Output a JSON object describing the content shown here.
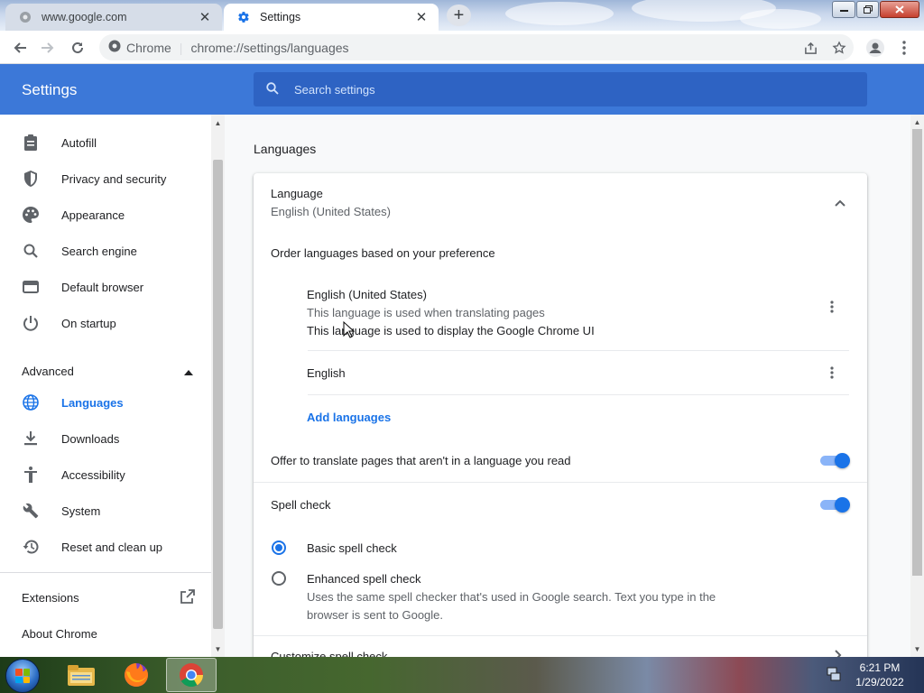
{
  "tabs": [
    {
      "title": "www.google.com",
      "close": "✕"
    },
    {
      "title": "Settings",
      "close": "✕"
    }
  ],
  "new_tab": "+",
  "omnibox": {
    "site_chip": "Chrome",
    "separator": "|",
    "url": "chrome://settings/languages"
  },
  "settings": {
    "title": "Settings",
    "search_placeholder": "Search settings"
  },
  "sidebar": {
    "items": [
      {
        "label": "Autofill",
        "icon": "clipboard-icon"
      },
      {
        "label": "Privacy and security",
        "icon": "shield-icon"
      },
      {
        "label": "Appearance",
        "icon": "palette-icon"
      },
      {
        "label": "Search engine",
        "icon": "search-icon"
      },
      {
        "label": "Default browser",
        "icon": "browser-window-icon"
      },
      {
        "label": "On startup",
        "icon": "power-icon"
      }
    ],
    "advanced_label": "Advanced",
    "advanced_items": [
      {
        "label": "Languages",
        "icon": "globe-icon",
        "selected": true
      },
      {
        "label": "Downloads",
        "icon": "download-icon"
      },
      {
        "label": "Accessibility",
        "icon": "accessibility-icon"
      },
      {
        "label": "System",
        "icon": "wrench-icon"
      },
      {
        "label": "Reset and clean up",
        "icon": "history-icon"
      }
    ],
    "extensions_label": "Extensions",
    "about_label": "About Chrome"
  },
  "main": {
    "section_title": "Languages",
    "language": {
      "label": "Language",
      "value": "English (United States)"
    },
    "order_text": "Order languages based on your preference",
    "languages": [
      {
        "name": "English (United States)",
        "notes": [
          "This language is used when translating pages",
          "This language is used to display the Google Chrome UI"
        ]
      },
      {
        "name": "English",
        "notes": []
      }
    ],
    "add_languages": "Add languages",
    "offer_translate": {
      "label": "Offer to translate pages that aren't in a language you read",
      "enabled": true
    },
    "spell_check": {
      "label": "Spell check",
      "enabled": true
    },
    "spell_options": [
      {
        "label": "Basic spell check",
        "checked": true,
        "description": ""
      },
      {
        "label": "Enhanced spell check",
        "checked": false,
        "description_line1": "Uses the same spell checker that's used in Google search. Text you type in the",
        "description_line2": "browser is sent to Google."
      }
    ],
    "customize_spell_check": "Customize spell check"
  },
  "taskbar": {
    "time": "6:21 PM",
    "date": "1/29/2022",
    "apps": [
      "windows-explorer-icon",
      "firefox-icon",
      "chrome-icon"
    ]
  },
  "colors": {
    "accent": "#1a73e8",
    "header": "#3c78d8",
    "search_bg": "#2e63c3"
  }
}
